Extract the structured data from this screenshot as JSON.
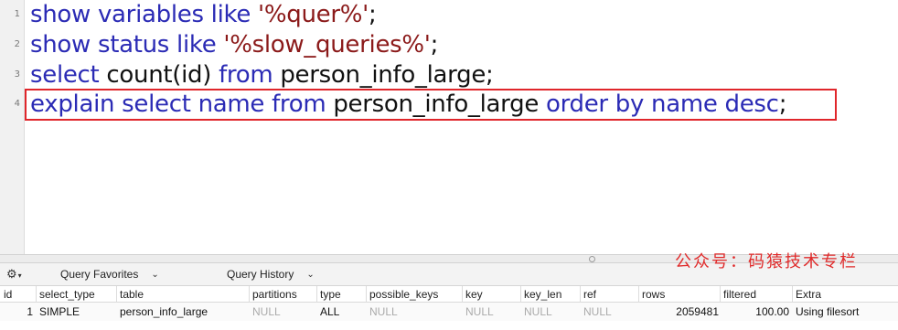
{
  "editor": {
    "lines": [
      {
        "num": "1",
        "tokens": [
          {
            "t": "show variables like ",
            "c": "kw"
          },
          {
            "t": "'%quer%'",
            "c": "str"
          },
          {
            "t": ";",
            "c": "plain"
          }
        ]
      },
      {
        "num": "2",
        "tokens": [
          {
            "t": "show status like ",
            "c": "kw"
          },
          {
            "t": "'%slow_queries%'",
            "c": "str"
          },
          {
            "t": ";",
            "c": "plain"
          }
        ]
      },
      {
        "num": "3",
        "tokens": [
          {
            "t": "select ",
            "c": "kw"
          },
          {
            "t": "count(id) ",
            "c": "plain"
          },
          {
            "t": "from ",
            "c": "kw"
          },
          {
            "t": "person_info_large;",
            "c": "plain"
          }
        ]
      },
      {
        "num": "4",
        "tokens": [
          {
            "t": "explain select name from ",
            "c": "kw"
          },
          {
            "t": "person_info_large ",
            "c": "plain"
          },
          {
            "t": "order by name desc",
            "c": "kw"
          },
          {
            "t": ";",
            "c": "plain"
          }
        ]
      }
    ]
  },
  "toolbar": {
    "gear_icon": "gear-icon",
    "query_favorites": "Query Favorites",
    "query_history": "Query History"
  },
  "watermark": "公众号：码猿技术专栏",
  "results": {
    "columns": [
      "id",
      "select_type",
      "table",
      "partitions",
      "type",
      "possible_keys",
      "key",
      "key_len",
      "ref",
      "rows",
      "filtered",
      "Extra"
    ],
    "rows": [
      [
        "1",
        "SIMPLE",
        "person_info_large",
        "NULL",
        "ALL",
        "NULL",
        "NULL",
        "NULL",
        "NULL",
        "2059481",
        "100.00",
        "Using filesort"
      ]
    ]
  }
}
